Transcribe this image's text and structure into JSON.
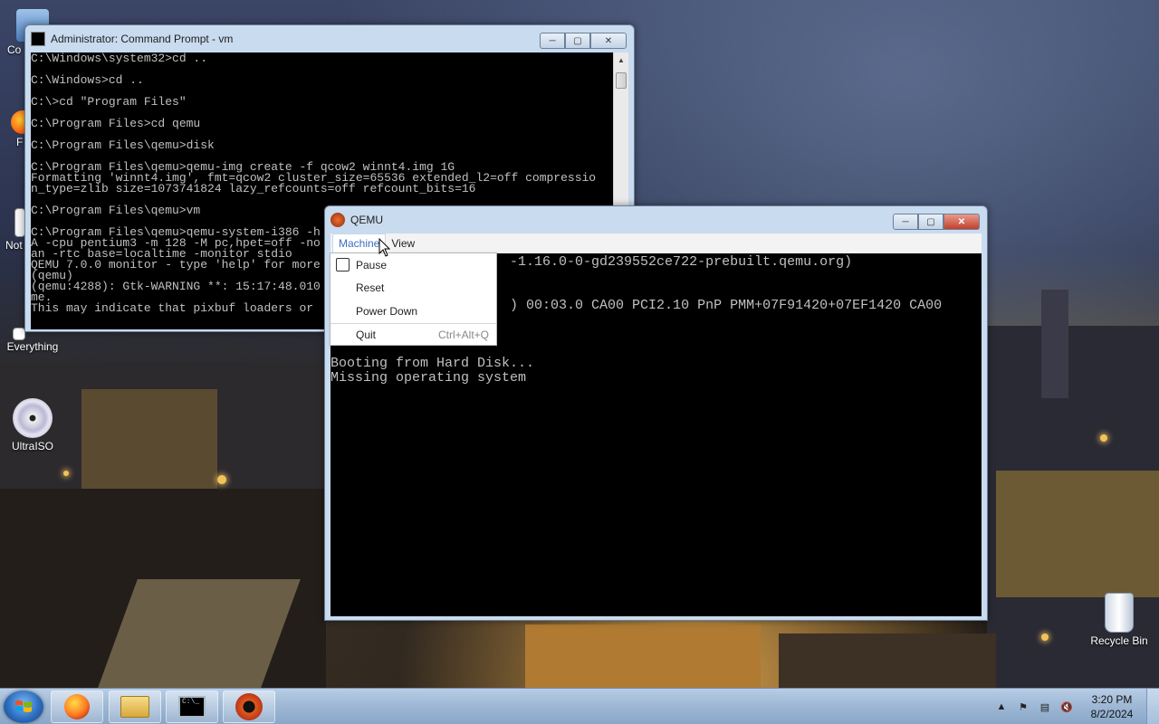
{
  "desktop": {
    "icons": [
      {
        "label": "Co"
      },
      {
        "label": "F"
      },
      {
        "label": "Not"
      },
      {
        "label": "Everything"
      },
      {
        "label": "UltraISO"
      },
      {
        "label": "Recycle Bin"
      }
    ]
  },
  "cmd_window": {
    "title": "Administrator:  Command Prompt - vm",
    "lines": [
      "C:\\Windows\\system32>cd ..",
      "",
      "C:\\Windows>cd ..",
      "",
      "C:\\>cd \"Program Files\"",
      "",
      "C:\\Program Files>cd qemu",
      "",
      "C:\\Program Files\\qemu>disk",
      "",
      "C:\\Program Files\\qemu>qemu-img create -f qcow2 winnt4.img 1G",
      "Formatting 'winnt4.img', fmt=qcow2 cluster_size=65536 extended_l2=off compressio",
      "n_type=zlib size=1073741824 lazy_refcounts=off refcount_bits=16",
      "",
      "C:\\Program Files\\qemu>vm",
      "",
      "C:\\Program Files\\qemu>qemu-system-i386 -h",
      "A -cpu pentium3 -m 128 -M pc,hpet=off -no",
      "an -rtc base=localtime -monitor stdio",
      "QEMU 7.0.0 monitor - type 'help' for more",
      "(qemu)",
      "(qemu:4288): Gtk-WARNING **: 15:17:48.010",
      "me.",
      "This may indicate that pixbuf loaders or"
    ]
  },
  "qemu_window": {
    "title": "QEMU",
    "menu": [
      "Machine",
      "View"
    ],
    "screen_lines": [
      "                      -1.16.0-0-gd239552ce722-prebuilt.qemu.org)",
      "",
      "",
      "                      ) 00:03.0 CA00 PCI2.10 PnP PMM+07F91420+07EF1420 CA00",
      "",
      "",
      "",
      "Booting from Hard Disk...",
      "Missing operating system"
    ],
    "machine_menu": {
      "items": [
        {
          "label": "Pause",
          "shortcut": "",
          "checkbox": true
        },
        {
          "label": "Reset",
          "shortcut": ""
        },
        {
          "label": "Power Down",
          "shortcut": ""
        },
        {
          "label": "Quit",
          "shortcut": "Ctrl+Alt+Q"
        }
      ]
    }
  },
  "taskbar": {
    "buttons": [
      "firefox-icon",
      "file-explorer-icon",
      "command-prompt-icon",
      "qemu-icon"
    ],
    "clock": {
      "time": "3:20 PM",
      "date": "8/2/2024"
    }
  }
}
